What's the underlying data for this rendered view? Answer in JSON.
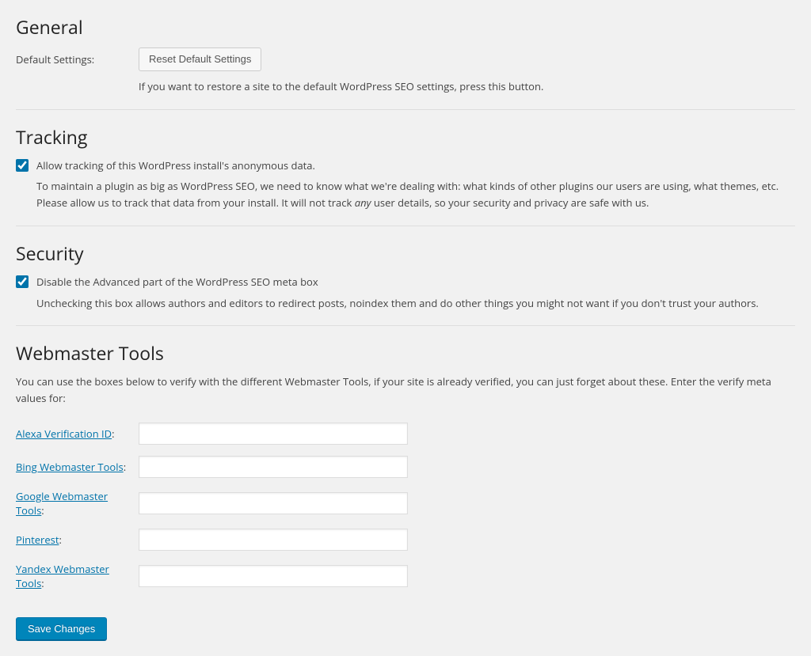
{
  "general": {
    "heading": "General",
    "default_settings_label": "Default Settings:",
    "reset_button": "Reset Default Settings",
    "reset_help": "If you want to restore a site to the default WordPress SEO settings, press this button."
  },
  "tracking": {
    "heading": "Tracking",
    "checkbox_label": "Allow tracking of this WordPress install's anonymous data.",
    "checkbox_checked": true,
    "desc_part1": "To maintain a plugin as big as WordPress SEO, we need to know what we're dealing with: what kinds of other plugins our users are using, what themes, etc. Please allow us to track that data from your install. It will not track ",
    "desc_em": "any",
    "desc_part2": " user details, so your security and privacy are safe with us."
  },
  "security": {
    "heading": "Security",
    "checkbox_label": "Disable the Advanced part of the WordPress SEO meta box",
    "checkbox_checked": true,
    "desc": "Unchecking this box allows authors and editors to redirect posts, noindex them and do other things you might not want if you don't trust your authors."
  },
  "webmaster": {
    "heading": "Webmaster Tools",
    "intro": "You can use the boxes below to verify with the different Webmaster Tools, if your site is already verified, you can just forget about these. Enter the verify meta values for:",
    "fields": {
      "alexa": {
        "label": "Alexa Verification ID",
        "value": ""
      },
      "bing": {
        "label": "Bing Webmaster Tools",
        "value": ""
      },
      "google": {
        "label": "Google Webmaster Tools",
        "value": ""
      },
      "pinterest": {
        "label": "Pinterest",
        "value": ""
      },
      "yandex": {
        "label": "Yandex Webmaster Tools",
        "value": ""
      }
    }
  },
  "save_button": "Save Changes"
}
